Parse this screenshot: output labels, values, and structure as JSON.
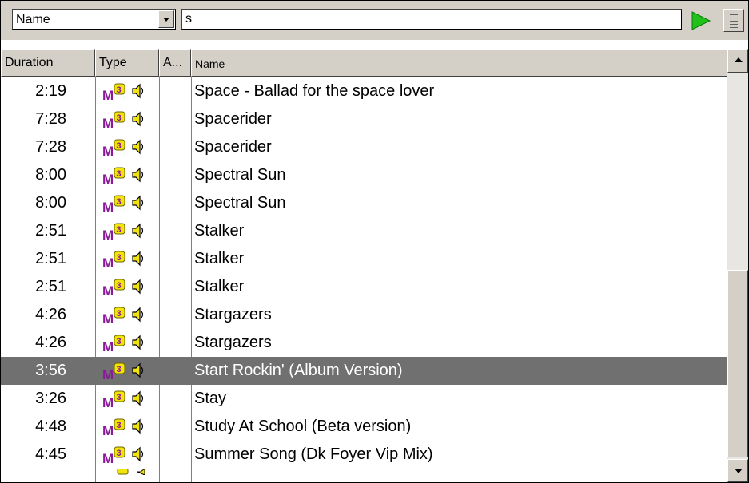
{
  "search": {
    "field_selected": "Name",
    "query": "s"
  },
  "columns": {
    "duration": "Duration",
    "type": "Type",
    "album": "A...",
    "name": "Name"
  },
  "rows": [
    {
      "duration": "2:19",
      "name": "Space - Ballad for the space lover",
      "selected": false
    },
    {
      "duration": "7:28",
      "name": "Spacerider",
      "selected": false
    },
    {
      "duration": "7:28",
      "name": "Spacerider",
      "selected": false
    },
    {
      "duration": "8:00",
      "name": "Spectral Sun",
      "selected": false
    },
    {
      "duration": "8:00",
      "name": "Spectral Sun",
      "selected": false
    },
    {
      "duration": "2:51",
      "name": "Stalker",
      "selected": false
    },
    {
      "duration": "2:51",
      "name": "Stalker",
      "selected": false
    },
    {
      "duration": "2:51",
      "name": "Stalker",
      "selected": false
    },
    {
      "duration": "4:26",
      "name": "Stargazers",
      "selected": false
    },
    {
      "duration": "4:26",
      "name": "Stargazers",
      "selected": false
    },
    {
      "duration": "3:56",
      "name": "Start Rockin' (Album Version)",
      "selected": true
    },
    {
      "duration": "3:26",
      "name": "Stay",
      "selected": false
    },
    {
      "duration": "4:48",
      "name": "Study At School (Beta version)",
      "selected": false
    },
    {
      "duration": "4:45",
      "name": "Summer Song (Dk Foyer Vip Mix)",
      "selected": false
    }
  ],
  "icons": {
    "type_icon": "mp3-file-icon",
    "audio_icon": "speaker-icon",
    "search_button": "play-icon",
    "menu_button": "list-menu-icon"
  },
  "colors": {
    "window_bg": "#d4d0c8",
    "selection": "#707070",
    "play_green": "#22c01a",
    "mp3_purple": "#8a1a9a",
    "mp3_yellow": "#f2e40a"
  }
}
